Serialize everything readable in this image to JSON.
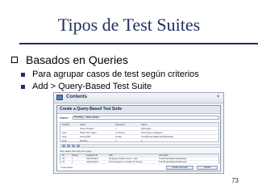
{
  "slide": {
    "title": "Tipos de Test Suites",
    "bullets": {
      "level1": "Basados en Queries",
      "level2": [
        "Para agrupar casos de test según criterios",
        "Add > Query-Based Test Suite"
      ]
    },
    "page_number": "73"
  },
  "screenshot": {
    "window_title": "Contents",
    "dialog_title": "Create a Query-Based Test Suite",
    "name_label": "Name",
    "name_value": "Priority 1 test cases",
    "grid_columns": [
      "And/Or",
      "Field",
      "Operator",
      "Value"
    ],
    "grid_rows": [
      [
        "",
        "Team Project",
        "=",
        "@Project"
      ],
      [
        "And",
        "Work Item Type",
        "In Group",
        "Test Case Category"
      ],
      [
        "And",
        "Area Path",
        "Under",
        "TeamProject\\Ejemplo\\Release"
      ],
      [
        "And",
        "Priority",
        "=",
        "1"
      ]
    ],
    "results_label": "Test cases found by the query",
    "results_columns": [
      "ID",
      "Priority",
      "Assigned To",
      "Title",
      "Area Path"
    ],
    "results_rows": [
      [
        "23",
        "1",
        "Administrator",
        "Employee Details screen - Add",
        "TeamProject\\Ejemplo\\Release"
      ],
      [
        "24",
        "1",
        "Administrator",
        "Test Emergency Contacts for Emplo",
        "TeamProject\\Ejemplo\\Release"
      ]
    ],
    "results_count": "2 test cases",
    "buttons": {
      "ok": "Create test suite",
      "cancel": "Cancel"
    }
  }
}
